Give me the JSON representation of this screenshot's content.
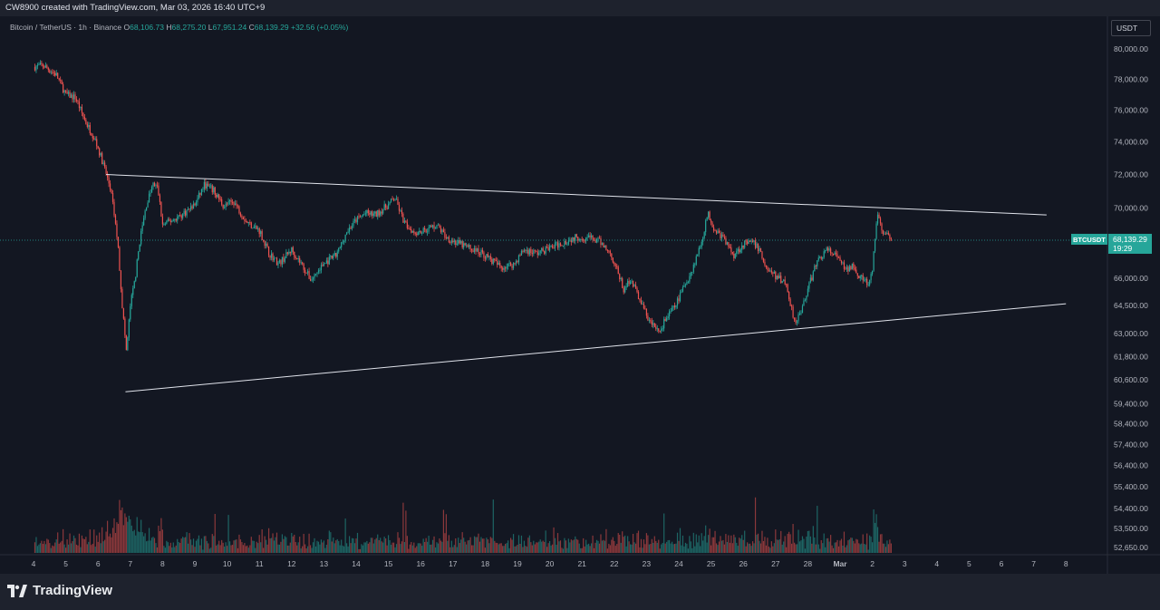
{
  "credit": "CW8900 created with TradingView.com, Mar 03, 2026 16:40 UTC+9",
  "legend": {
    "symbol": "Bitcoin / TetherUS · 1h · Binance",
    "o_label": "O",
    "o": "68,106.73",
    "h_label": "H",
    "h": "68,275.20",
    "l_label": "L",
    "l": "67,951.24",
    "c_label": "C",
    "c": "68,139.29",
    "change": "+32.56 (+0.05%)"
  },
  "currency": "USDT",
  "price_label": {
    "symbol": "BTCUSDT",
    "price": "68,139.29",
    "countdown": "19:29"
  },
  "brand": "TradingView",
  "colors": {
    "up": "#26a69a",
    "down": "#ef5350",
    "bg": "#131722",
    "line": "#e0e3eb"
  },
  "chart_data": {
    "type": "candlestick",
    "y_axis": {
      "scale": "log",
      "ticks": [
        80000,
        78000,
        76000,
        74000,
        72000,
        70000,
        68000,
        66000,
        64500,
        63000,
        61800,
        60600,
        59400,
        58400,
        57400,
        56400,
        55400,
        54400,
        53500,
        52650
      ],
      "tick_labels": [
        "80,000.00",
        "78,000.00",
        "76,000.00",
        "74,000.00",
        "72,000.00",
        "70,000.00",
        "68,000.00",
        "66,000.00",
        "64,500.00",
        "63,000.00",
        "61,800.00",
        "60,600.00",
        "59,400.00",
        "58,400.00",
        "57,400.00",
        "56,400.00",
        "55,400.00",
        "54,400.00",
        "53,500.00",
        "52,650.00"
      ]
    },
    "x_axis": {
      "ticks": [
        "4",
        "5",
        "6",
        "7",
        "8",
        "9",
        "10",
        "11",
        "12",
        "13",
        "14",
        "15",
        "16",
        "17",
        "18",
        "19",
        "20",
        "21",
        "22",
        "23",
        "24",
        "25",
        "26",
        "27",
        "28",
        "Mar",
        "2",
        "3",
        "4",
        "5",
        "6",
        "7",
        "8"
      ]
    },
    "key_closes": [
      [
        0,
        78800
      ],
      [
        0.3,
        78900
      ],
      [
        0.7,
        78300
      ],
      [
        1.0,
        77000
      ],
      [
        1.3,
        76800
      ],
      [
        1.6,
        75300
      ],
      [
        1.9,
        74200
      ],
      [
        2.2,
        72400
      ],
      [
        2.4,
        71000
      ],
      [
        2.6,
        68200
      ],
      [
        2.75,
        64500
      ],
      [
        2.88,
        62000
      ],
      [
        3.0,
        64500
      ],
      [
        3.15,
        66000
      ],
      [
        3.3,
        68200
      ],
      [
        3.5,
        70200
      ],
      [
        3.7,
        71400
      ],
      [
        3.85,
        71200
      ],
      [
        4.0,
        69000
      ],
      [
        4.3,
        69300
      ],
      [
        4.6,
        69600
      ],
      [
        5.0,
        70200
      ],
      [
        5.3,
        71400
      ],
      [
        5.6,
        71000
      ],
      [
        5.9,
        70100
      ],
      [
        6.2,
        70400
      ],
      [
        6.6,
        69200
      ],
      [
        7.0,
        68700
      ],
      [
        7.3,
        67400
      ],
      [
        7.6,
        66800
      ],
      [
        8.0,
        67600
      ],
      [
        8.3,
        66800
      ],
      [
        8.6,
        65900
      ],
      [
        9.0,
        66800
      ],
      [
        9.4,
        67300
      ],
      [
        9.7,
        68600
      ],
      [
        10.0,
        69300
      ],
      [
        10.3,
        69700
      ],
      [
        10.6,
        69600
      ],
      [
        11.0,
        70200
      ],
      [
        11.2,
        70600
      ],
      [
        11.5,
        69100
      ],
      [
        11.8,
        68600
      ],
      [
        12.1,
        68700
      ],
      [
        12.5,
        69000
      ],
      [
        12.8,
        68300
      ],
      [
        13.1,
        68000
      ],
      [
        13.5,
        67700
      ],
      [
        13.9,
        67400
      ],
      [
        14.2,
        67000
      ],
      [
        14.5,
        66600
      ],
      [
        14.9,
        66800
      ],
      [
        15.2,
        67600
      ],
      [
        15.6,
        67400
      ],
      [
        16.0,
        67700
      ],
      [
        16.4,
        68000
      ],
      [
        16.8,
        68300
      ],
      [
        17.2,
        68300
      ],
      [
        17.6,
        68000
      ],
      [
        17.9,
        67300
      ],
      [
        18.1,
        66400
      ],
      [
        18.3,
        65300
      ],
      [
        18.5,
        66000
      ],
      [
        18.8,
        64800
      ],
      [
        19.1,
        63600
      ],
      [
        19.4,
        63100
      ],
      [
        19.6,
        63800
      ],
      [
        19.9,
        64500
      ],
      [
        20.1,
        65300
      ],
      [
        20.4,
        66400
      ],
      [
        20.7,
        68000
      ],
      [
        20.9,
        69700
      ],
      [
        21.1,
        68800
      ],
      [
        21.4,
        68200
      ],
      [
        21.7,
        67300
      ],
      [
        22.0,
        67900
      ],
      [
        22.3,
        68000
      ],
      [
        22.5,
        67600
      ],
      [
        22.7,
        66600
      ],
      [
        23.0,
        66100
      ],
      [
        23.3,
        65800
      ],
      [
        23.6,
        63600
      ],
      [
        23.8,
        64300
      ],
      [
        24.0,
        65400
      ],
      [
        24.3,
        67000
      ],
      [
        24.6,
        67600
      ],
      [
        24.9,
        67200
      ],
      [
        25.2,
        66400
      ],
      [
        25.4,
        66800
      ],
      [
        25.6,
        66100
      ],
      [
        25.9,
        65600
      ],
      [
        26.0,
        66400
      ],
      [
        26.15,
        69700
      ],
      [
        26.3,
        68700
      ],
      [
        26.5,
        68300
      ],
      [
        26.6,
        68000
      ]
    ],
    "trendlines": [
      {
        "name": "upper",
        "points": [
          [
            2.25,
            72000
          ],
          [
            31.4,
            69600
          ]
        ]
      },
      {
        "name": "lower",
        "points": [
          [
            2.85,
            60000
          ],
          [
            32.0,
            64600
          ]
        ]
      }
    ],
    "last_price": 68139.29
  }
}
